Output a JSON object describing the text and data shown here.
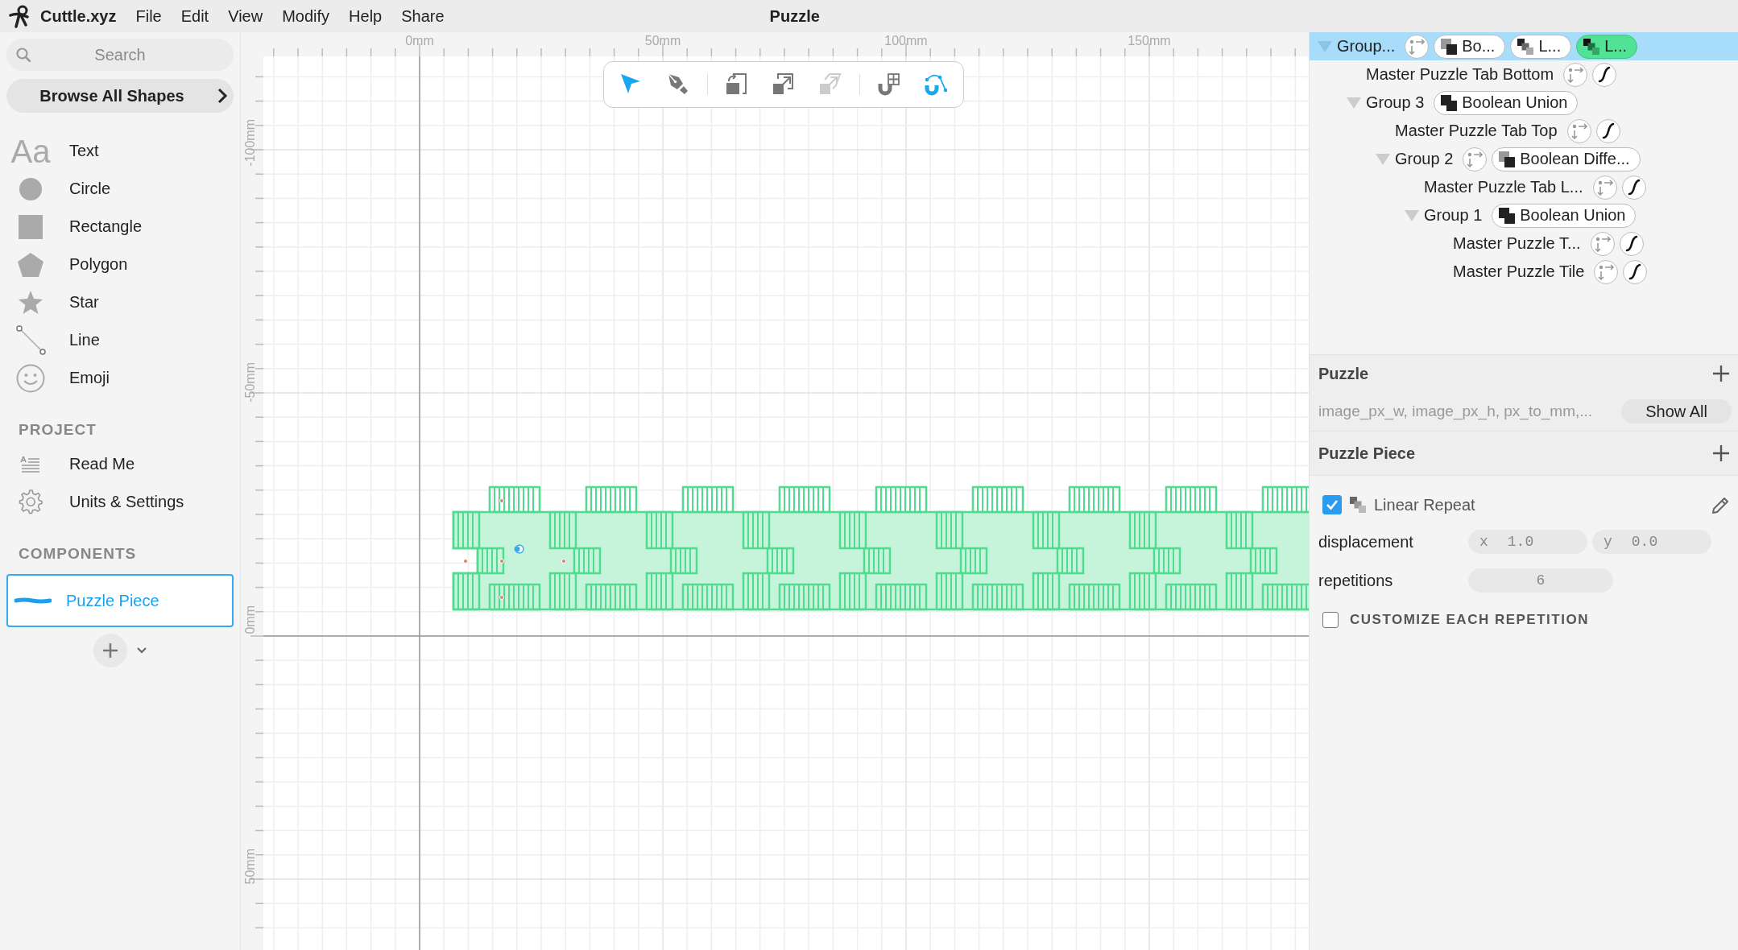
{
  "menu_bar": {
    "app_name": "Cuttle.xyz",
    "menus": [
      "File",
      "Edit",
      "View",
      "Modify",
      "Help",
      "Share"
    ],
    "document_title": "Puzzle"
  },
  "sidebar": {
    "search": {
      "placeholder": "Search"
    },
    "browse_button": "Browse All Shapes",
    "shapes": [
      {
        "kind": "text",
        "glyph": "Aa",
        "label": "Text"
      },
      {
        "kind": "circle",
        "label": "Circle"
      },
      {
        "kind": "rectangle",
        "label": "Rectangle"
      },
      {
        "kind": "polygon",
        "label": "Polygon"
      },
      {
        "kind": "star",
        "label": "Star"
      },
      {
        "kind": "line",
        "label": "Line"
      },
      {
        "kind": "emoji",
        "label": "Emoji"
      }
    ],
    "project_heading": "PROJECT",
    "project_items": [
      {
        "kind": "readme",
        "label": "Read Me"
      },
      {
        "kind": "settings",
        "label": "Units & Settings"
      }
    ],
    "components_heading": "COMPONENTS",
    "components": [
      {
        "label": "Puzzle Piece",
        "selected": true
      }
    ]
  },
  "rulers": {
    "x_labels": [
      "0mm",
      "50mm",
      "100mm",
      "150mm"
    ],
    "y_labels": [
      "-100mm",
      "-50mm",
      "0mm",
      "50mm"
    ]
  },
  "toolbar": {
    "tool_groups": [
      [
        {
          "kind": "pointer",
          "active": true,
          "disabled": false
        },
        {
          "kind": "pen",
          "active": false,
          "disabled": false
        }
      ],
      [
        {
          "kind": "rotate",
          "active": false,
          "disabled": false
        },
        {
          "kind": "scale",
          "active": false,
          "disabled": false
        },
        {
          "kind": "skew",
          "active": false,
          "disabled": true
        }
      ],
      [
        {
          "kind": "snap_grid",
          "active": false,
          "disabled": false
        },
        {
          "kind": "snap_curve",
          "active": true,
          "disabled": false
        }
      ]
    ]
  },
  "tree": [
    {
      "label": "Group...",
      "selected": true,
      "expanded": true,
      "badges": [
        {
          "kind": "transform"
        },
        {
          "kind": "boolean_difference",
          "label": "Bo...",
          "active": false
        },
        {
          "kind": "repeat",
          "label": "L...",
          "active": false
        },
        {
          "kind": "repeat",
          "label": "L...",
          "active": true
        }
      ],
      "children": [
        {
          "label": "Master Puzzle Tab Bottom",
          "selected": false,
          "badges": [
            {
              "kind": "transform"
            },
            {
              "kind": "path"
            }
          ]
        },
        {
          "label": "Group 3",
          "selected": false,
          "expanded": true,
          "badges": [
            {
              "kind": "boolean_union",
              "label": "Boolean Union",
              "active": false
            }
          ],
          "children": [
            {
              "label": "Master Puzzle Tab Top",
              "selected": false,
              "badges": [
                {
                  "kind": "transform"
                },
                {
                  "kind": "path"
                }
              ]
            },
            {
              "label": "Group 2",
              "selected": false,
              "expanded": true,
              "badges": [
                {
                  "kind": "transform"
                },
                {
                  "kind": "boolean_difference",
                  "label": "Boolean Diffe...",
                  "active": false
                }
              ],
              "children": [
                {
                  "label": "Master Puzzle Tab L...",
                  "selected": false,
                  "badges": [
                    {
                      "kind": "transform"
                    },
                    {
                      "kind": "path"
                    }
                  ]
                },
                {
                  "label": "Group 1",
                  "selected": false,
                  "expanded": true,
                  "badges": [
                    {
                      "kind": "boolean_union",
                      "label": "Boolean Union",
                      "active": false
                    }
                  ],
                  "children": [
                    {
                      "label": "Master Puzzle T...",
                      "selected": false,
                      "badges": [
                        {
                          "kind": "transform"
                        },
                        {
                          "kind": "path"
                        }
                      ]
                    },
                    {
                      "label": "Master Puzzle Tile",
                      "selected": false,
                      "badges": [
                        {
                          "kind": "transform"
                        },
                        {
                          "kind": "path"
                        }
                      ]
                    }
                  ]
                }
              ]
            }
          ]
        }
      ]
    }
  ],
  "parameters": {
    "title": "Puzzle",
    "summary": "image_px_w, image_px_h, px_to_mm,...",
    "show_all_button": "Show All"
  },
  "component_panel": {
    "title": "Puzzle Piece",
    "modifier": {
      "checked": true,
      "label": "Linear Repeat"
    },
    "displacement": {
      "label": "displacement",
      "x": {
        "axis": "x",
        "value": "1.0"
      },
      "y": {
        "axis": "y",
        "value": "0.0"
      }
    },
    "repetitions": {
      "label": "repetitions",
      "value": "6"
    },
    "customize": {
      "checked": false,
      "label": "CUSTOMIZE EACH REPETITION"
    }
  }
}
